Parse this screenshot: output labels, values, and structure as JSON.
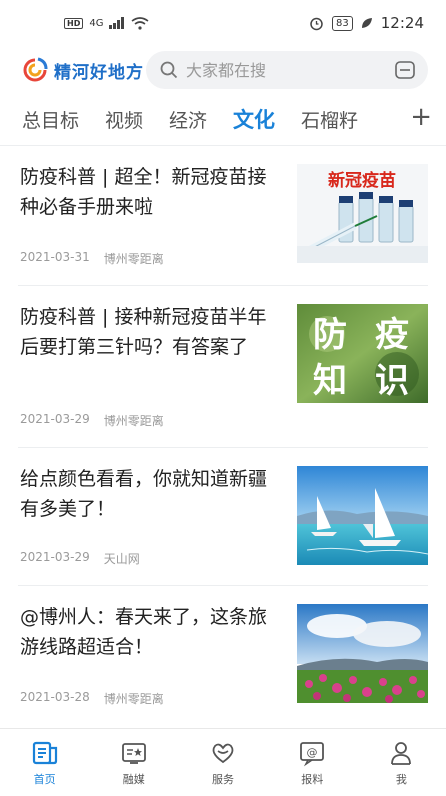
{
  "status_bar": {
    "network_badge": "HD",
    "signal": "4G",
    "battery": "83",
    "time": "12:24"
  },
  "header": {
    "app_name": "精河好地方",
    "search_placeholder": "大家都在搜"
  },
  "tabs": [
    {
      "label": "总目标",
      "active": false
    },
    {
      "label": "视频",
      "active": false
    },
    {
      "label": "经济",
      "active": false
    },
    {
      "label": "文化",
      "active": true
    },
    {
      "label": "石榴籽",
      "active": false
    }
  ],
  "tabs_more": "+",
  "feed": [
    {
      "title": "防疫科普 | 超全！新冠疫苗接种必备手册来啦",
      "date": "2021-03-31",
      "source": "博州零距离",
      "thumb_text": "新冠疫苗"
    },
    {
      "title": "防疫科普 | 接种新冠疫苗半年后要打第三针吗？有答案了",
      "date": "2021-03-29",
      "source": "博州零距离",
      "thumb_chars": [
        "防",
        "疫",
        "知",
        "识"
      ]
    },
    {
      "title": "给点颜色看看，你就知道新疆有多美了！",
      "date": "2021-03-29",
      "source": "天山网"
    },
    {
      "title": "@博州人：春天来了，这条旅游线路超适合！",
      "date": "2021-03-28",
      "source": "博州零距离"
    }
  ],
  "bottom_nav": [
    {
      "label": "首页",
      "icon": "news-icon",
      "active": true
    },
    {
      "label": "融媒",
      "icon": "media-icon",
      "active": false
    },
    {
      "label": "服务",
      "icon": "heart-icon",
      "active": false
    },
    {
      "label": "报料",
      "icon": "report-icon",
      "active": false
    },
    {
      "label": "我",
      "icon": "person-icon",
      "active": false
    }
  ],
  "colors": {
    "accent": "#1a82d8",
    "brand": "#1f6fc8"
  }
}
